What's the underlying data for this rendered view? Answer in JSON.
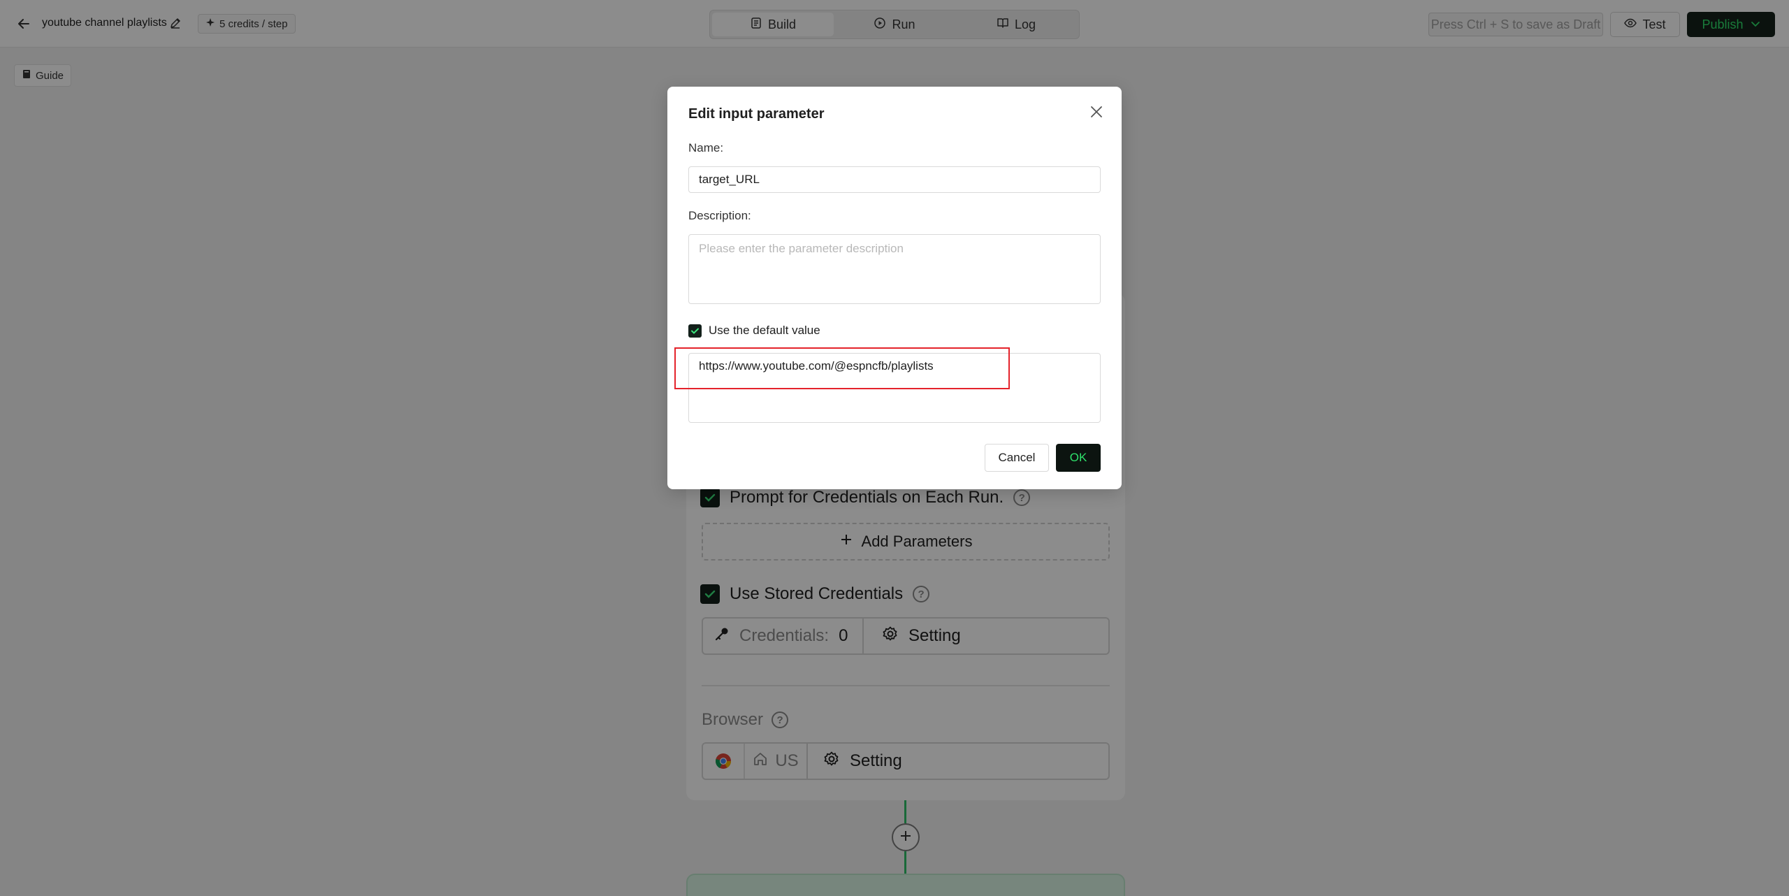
{
  "header": {
    "project_name": "youtube channel playlists",
    "credits": "5 credits / step",
    "tabs": [
      {
        "label": "Build",
        "icon": "build-icon",
        "active": true
      },
      {
        "label": "Run",
        "icon": "play-circle-icon",
        "active": false
      },
      {
        "label": "Log",
        "icon": "book-icon",
        "active": false
      }
    ],
    "draft_hint": "Press Ctrl + S to save as Draft",
    "test_label": "Test",
    "publish_label": "Publish"
  },
  "guide": {
    "label": "Guide"
  },
  "node": {
    "prompt_credentials": "Prompt for Credentials on Each Run.",
    "add_parameters": "Add Parameters",
    "use_stored_credentials": "Use Stored Credentials",
    "credentials_label": "Credentials:",
    "credentials_count": "0",
    "setting_label": "Setting",
    "browser_label": "Browser",
    "region": "US",
    "browser_setting_label": "Setting"
  },
  "modal": {
    "title": "Edit input parameter",
    "name_label": "Name:",
    "name_value": "target_URL",
    "description_label": "Description:",
    "description_placeholder": "Please enter the parameter description",
    "description_value": "",
    "use_default_label": "Use the default value",
    "use_default_checked": true,
    "default_value": "https://www.youtube.com/@espncfb/playlists",
    "cancel_label": "Cancel",
    "ok_label": "OK"
  },
  "colors": {
    "accent_green": "#2ee06a",
    "dark": "#13201b",
    "highlight_red": "#e4232b"
  }
}
